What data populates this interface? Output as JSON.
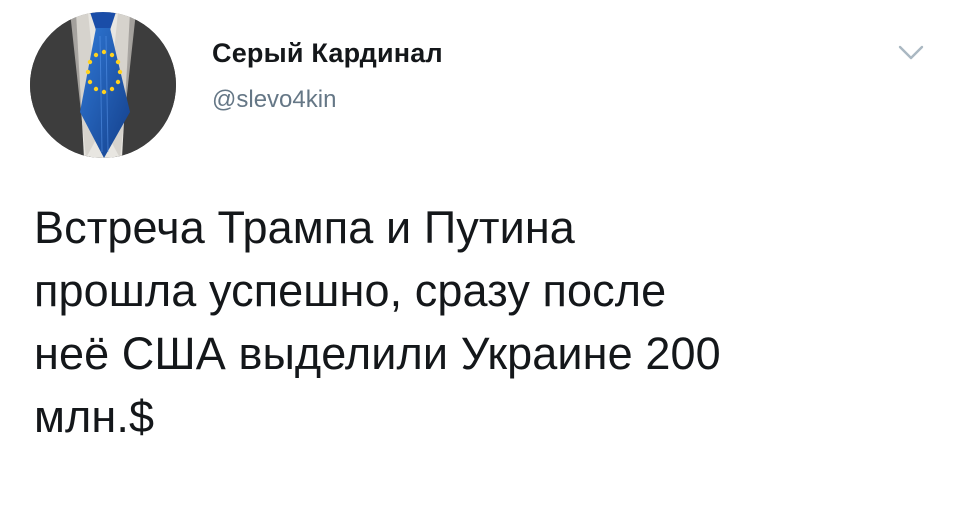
{
  "tweet": {
    "author": {
      "display_name": "Серый Кардинал",
      "handle": "@slevo4kin",
      "avatar_icon": "suit-eu-tie-avatar"
    },
    "menu_icon": "chevron-down-icon",
    "text": "Встреча Трампа и Путина\nпрошла успешно, сразу после\nнеё США выделили Украине 200\nмлн.$"
  },
  "colors": {
    "name": "#14171a",
    "handle": "#657786",
    "text": "#14171a",
    "caret": "#aab8c2",
    "tie_blue": "#1f5fbf",
    "tie_star": "#ffd21f"
  }
}
